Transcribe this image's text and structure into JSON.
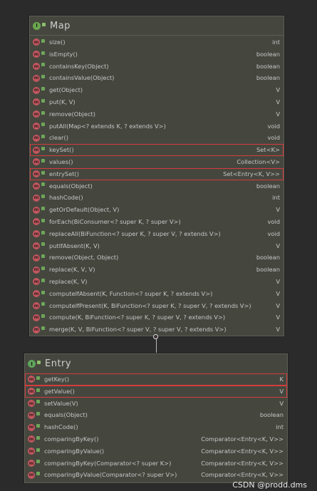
{
  "map": {
    "title": "Map",
    "icon": "interface-icon",
    "methods": [
      {
        "sig": "size()",
        "ret": "int",
        "highlight": false
      },
      {
        "sig": "isEmpty()",
        "ret": "boolean",
        "highlight": false
      },
      {
        "sig": "containsKey(Object)",
        "ret": "boolean",
        "highlight": false
      },
      {
        "sig": "containsValue(Object)",
        "ret": "boolean",
        "highlight": false
      },
      {
        "sig": "get(Object)",
        "ret": "V",
        "highlight": false
      },
      {
        "sig": "put(K, V)",
        "ret": "V",
        "highlight": false
      },
      {
        "sig": "remove(Object)",
        "ret": "V",
        "highlight": false
      },
      {
        "sig": "putAll(Map<? extends K, ? extends V>)",
        "ret": "void",
        "highlight": false
      },
      {
        "sig": "clear()",
        "ret": "void",
        "highlight": false
      },
      {
        "sig": "keySet()",
        "ret": "Set<K>",
        "highlight": true
      },
      {
        "sig": "values()",
        "ret": "Collection<V>",
        "highlight": false
      },
      {
        "sig": "entrySet()",
        "ret": "Set<Entry<K, V>>",
        "highlight": true
      },
      {
        "sig": "equals(Object)",
        "ret": "boolean",
        "highlight": false
      },
      {
        "sig": "hashCode()",
        "ret": "int",
        "highlight": false
      },
      {
        "sig": "getOrDefault(Object, V)",
        "ret": "V",
        "highlight": false
      },
      {
        "sig": "forEach(BiConsumer<? super K, ? super V>)",
        "ret": "void",
        "highlight": false
      },
      {
        "sig": "replaceAll(BiFunction<? super K, ? super V, ? extends V>)",
        "ret": "void",
        "highlight": false
      },
      {
        "sig": "putIfAbsent(K, V)",
        "ret": "V",
        "highlight": false
      },
      {
        "sig": "remove(Object, Object)",
        "ret": "boolean",
        "highlight": false
      },
      {
        "sig": "replace(K, V, V)",
        "ret": "boolean",
        "highlight": false
      },
      {
        "sig": "replace(K, V)",
        "ret": "V",
        "highlight": false
      },
      {
        "sig": "computeIfAbsent(K, Function<? super K, ? extends V>)",
        "ret": "V",
        "highlight": false
      },
      {
        "sig": "computeIfPresent(K, BiFunction<? super K, ? super V, ? extends V>)",
        "ret": "V",
        "highlight": false
      },
      {
        "sig": "compute(K, BiFunction<? super K, ? super V, ? extends V>)",
        "ret": "V",
        "highlight": false
      },
      {
        "sig": "merge(K, V, BiFunction<? super V, ? super V, ? extends V>)",
        "ret": "V",
        "highlight": false
      }
    ]
  },
  "entry": {
    "title": "Entry",
    "icon": "interface-icon",
    "methods": [
      {
        "sig": "getKey()",
        "ret": "K",
        "highlight": true
      },
      {
        "sig": "getValue()",
        "ret": "V",
        "highlight": true
      },
      {
        "sig": "setValue(V)",
        "ret": "V",
        "highlight": false
      },
      {
        "sig": "equals(Object)",
        "ret": "boolean",
        "highlight": false
      },
      {
        "sig": "hashCode()",
        "ret": "int",
        "highlight": false
      },
      {
        "sig": "comparingByKey()",
        "ret": "Comparator<Entry<K, V>>",
        "highlight": false
      },
      {
        "sig": "comparingByValue()",
        "ret": "Comparator<Entry<K, V>>",
        "highlight": false
      },
      {
        "sig": "comparingByKey(Comparator<? super K>)",
        "ret": "Comparator<Entry<K, V>>",
        "highlight": false
      },
      {
        "sig": "comparingByValue(Comparator<? super V>)",
        "ret": "Comparator<Entry<K, V>>",
        "highlight": false
      }
    ]
  },
  "method_badge": "m",
  "interface_badge": "I",
  "colors": {
    "background": "#2b2b2b",
    "panel": "#45473f",
    "highlight": "#d33c3c",
    "method_icon": "#c2575f"
  },
  "watermark": "CSDN @prodd.dms"
}
